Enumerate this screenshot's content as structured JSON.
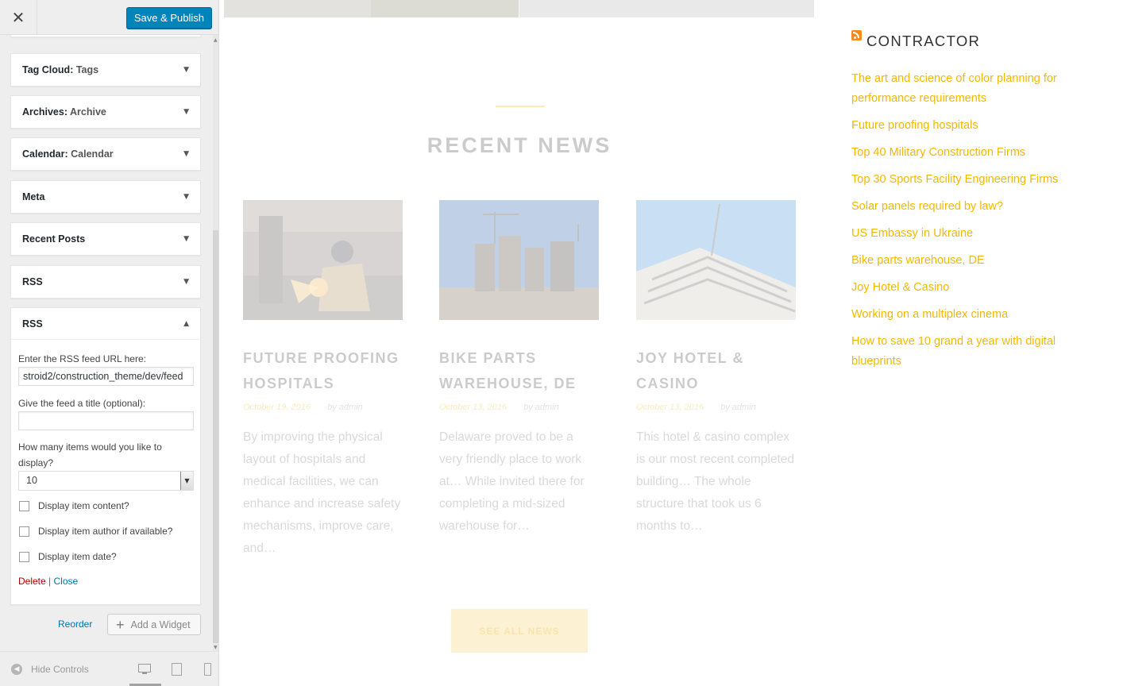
{
  "header": {
    "close_glyph": "✕",
    "save_label": "Save & Publish"
  },
  "widgets": [
    {
      "name": "Tag Cloud",
      "sep": ":",
      "sub": "Tags"
    },
    {
      "name": "Archives",
      "sep": ":",
      "sub": "Archive"
    },
    {
      "name": "Calendar",
      "sep": ":",
      "sub": "Calendar"
    },
    {
      "name": "Meta",
      "sep": "",
      "sub": ""
    },
    {
      "name": "Recent Posts",
      "sep": "",
      "sub": ""
    },
    {
      "name": "RSS",
      "sep": "",
      "sub": ""
    }
  ],
  "rss_widget": {
    "title": "RSS",
    "url_label": "Enter the RSS feed URL here:",
    "url_value": "stroid2/construction_theme/dev/feed",
    "title_label": "Give the feed a title (optional):",
    "title_value": "",
    "items_label": "How many items would you like to display?",
    "items_value": "10",
    "checkboxes": [
      {
        "label": "Display item content?",
        "checked": false
      },
      {
        "label": "Display item author if available?",
        "checked": false
      },
      {
        "label": "Display item date?",
        "checked": false
      }
    ],
    "delete_label": "Delete",
    "separator": "|",
    "close_label": "Close"
  },
  "sidebar_actions": {
    "reorder_label": "Reorder",
    "add_widget_label": "Add a Widget"
  },
  "footer": {
    "hide_controls_label": "Hide Controls"
  },
  "preview": {
    "section_title": "RECENT NEWS",
    "posts": [
      {
        "title": "FUTURE PROOFING HOSPITALS",
        "date": "October 19, 2016",
        "author": "by admin",
        "excerpt": "By improving the physical layout of hospitals and medical facilities, we can enhance and increase safety mechanisms, improve care, and…"
      },
      {
        "title": "BIKE PARTS WAREHOUSE, DE",
        "date": "October 13, 2016",
        "author": "by admin",
        "excerpt": "Delaware proved to be a very friendly place to work at… While invited there for completing a mid-sized warehouse for…"
      },
      {
        "title": "JOY HOTEL & CASINO",
        "date": "October 13, 2016",
        "author": "by admin",
        "excerpt": "This hotel & casino complex is our most recent completed building… The whole structure that took us 6 months to…"
      }
    ],
    "see_all_label": "SEE ALL NEWS",
    "rss_title": "CONTRACTOR",
    "feed_items": [
      "The art and science of color planning for performance requirements",
      "Future proofing hospitals",
      "Top 40 Military Construction Firms",
      "Top 30 Sports Facility Engineering Firms",
      "Solar panels required by law?",
      "US Embassy in Ukraine",
      "Bike parts warehouse, DE",
      "Joy Hotel & Casino",
      "Working on a multiplex cinema",
      "How to save 10 grand a year with digital blueprints"
    ]
  },
  "colors": {
    "accent": "#f5b800",
    "primary_button": "#0085ba",
    "delete": "#aa0000",
    "link": "#0073aa",
    "rss_orange": "#f68a1f"
  }
}
